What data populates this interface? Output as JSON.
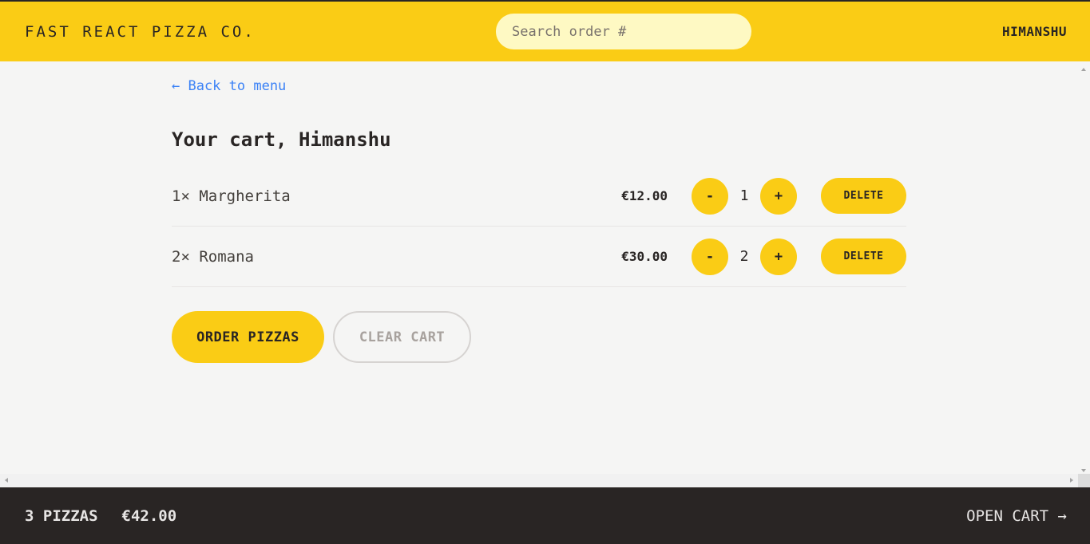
{
  "header": {
    "logo": "Fast React Pizza Co.",
    "search_placeholder": "Search order #",
    "username": "Himanshu"
  },
  "main": {
    "back_link": "← Back to menu",
    "title": "Your cart, Himanshu",
    "items": [
      {
        "name": "1× Margherita",
        "price": "€12.00",
        "quantity": "1",
        "decrease": "-",
        "increase": "+",
        "delete": "Delete"
      },
      {
        "name": "2× Romana",
        "price": "€30.00",
        "quantity": "2",
        "decrease": "-",
        "increase": "+",
        "delete": "Delete"
      }
    ],
    "order_button": "Order pizzas",
    "clear_button": "Clear cart"
  },
  "footer": {
    "pizza_count": "3 pizzas",
    "total": "€42.00",
    "open_cart": "Open cart →"
  },
  "colors": {
    "accent": "#facc15",
    "dark": "#292524",
    "link": "#3b82f6",
    "background": "#f5f5f4"
  }
}
